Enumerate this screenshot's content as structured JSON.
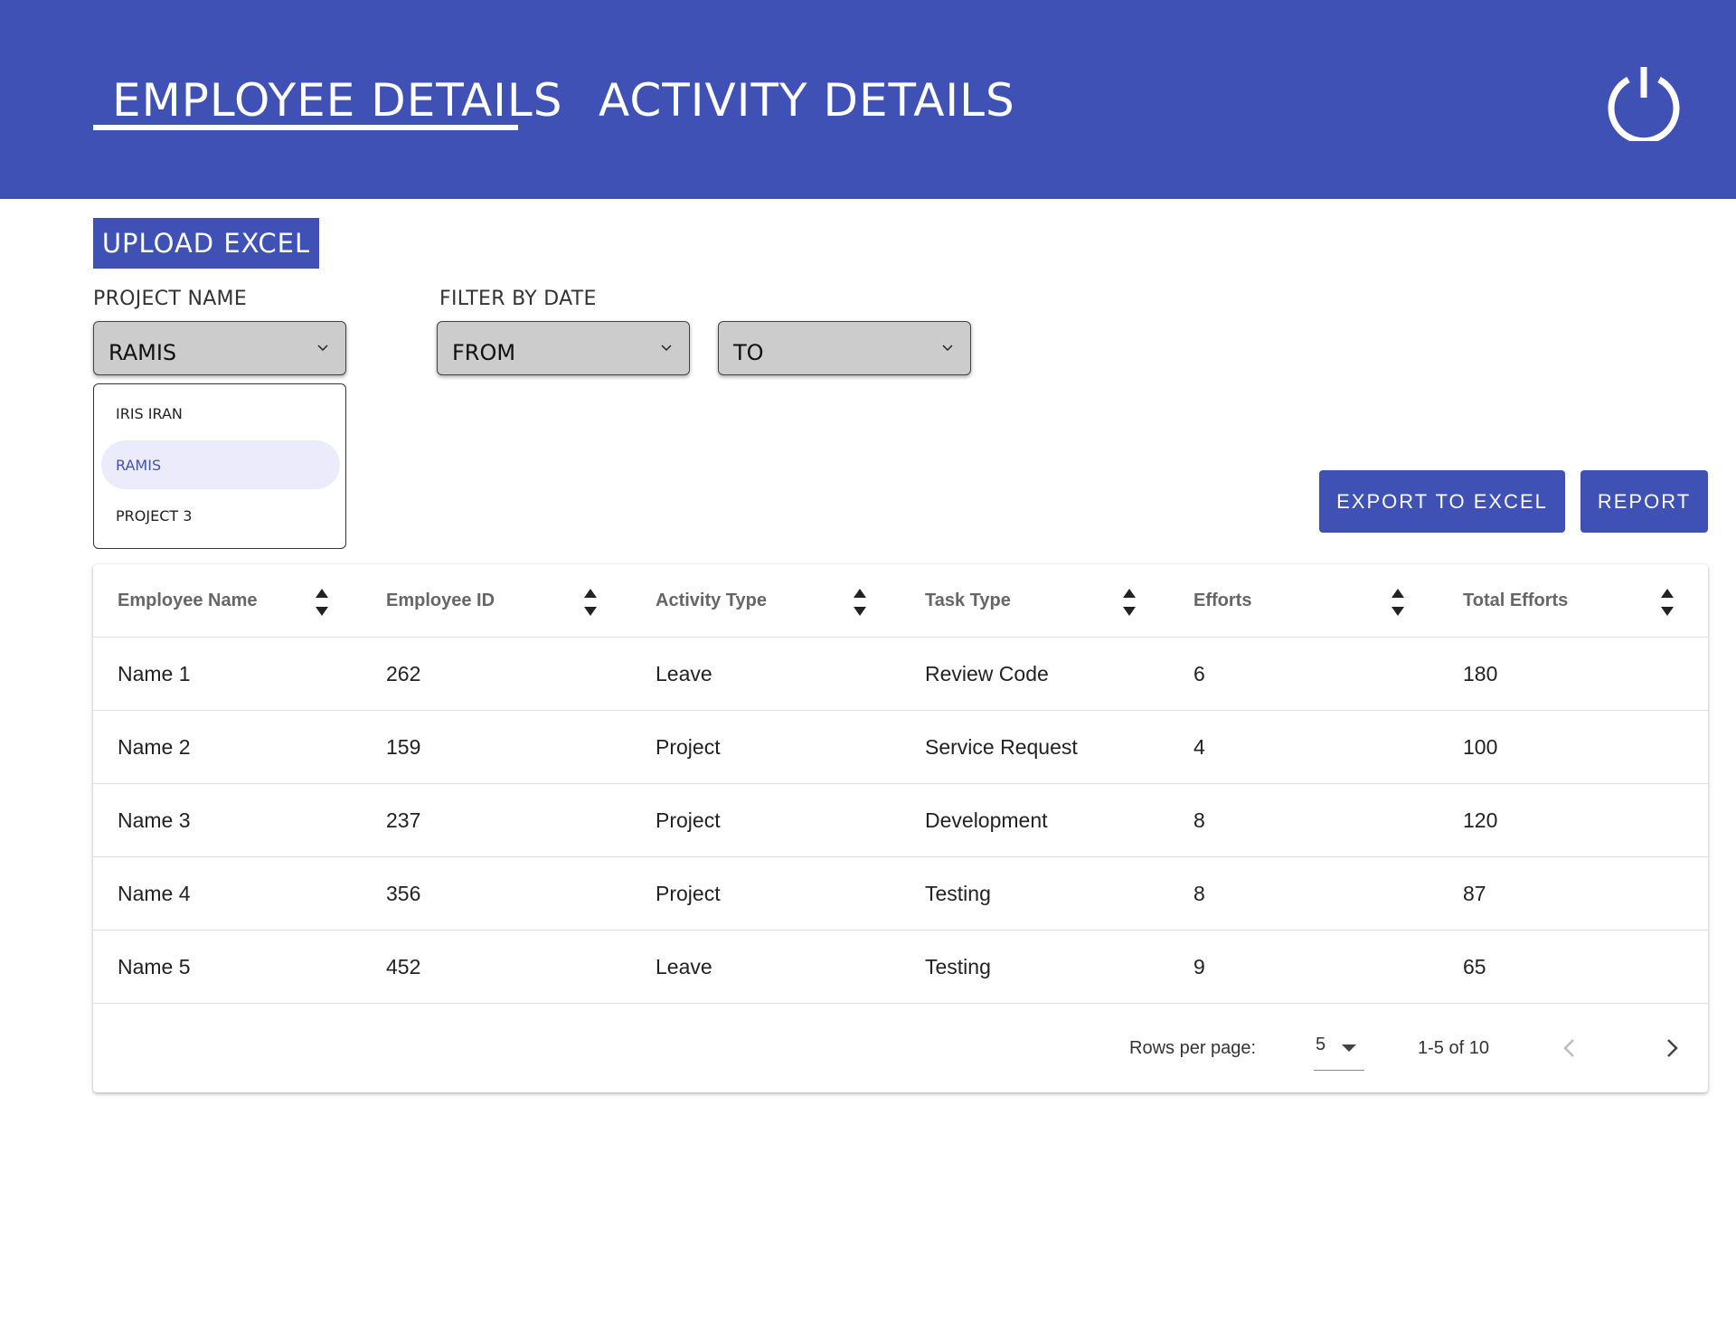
{
  "header": {
    "tabs": [
      {
        "label": "EMPLOYEE DETAILS",
        "active": true
      },
      {
        "label": "ACTIVITY DETAILS",
        "active": false
      }
    ],
    "power_icon": "power-icon",
    "background": "#3f51b5"
  },
  "upload": {
    "label": "UPLOAD EXCEL"
  },
  "filters": {
    "project": {
      "label": "PROJECT NAME",
      "value": "RAMIS",
      "options": [
        {
          "label": "IRIS IRAN",
          "selected": false
        },
        {
          "label": "RAMIS",
          "selected": true
        },
        {
          "label": "PROJECT 3",
          "selected": false
        }
      ]
    },
    "date": {
      "label": "FILTER BY DATE",
      "from": "FROM",
      "to": "TO"
    }
  },
  "actions": {
    "export_label": "EXPORT TO EXCEL",
    "report_label": "REPORT"
  },
  "table": {
    "columns": [
      "Employee Name",
      "Employee ID",
      "Activity Type",
      "Task Type",
      "Efforts",
      "Total Efforts"
    ],
    "rows": [
      [
        "Name 1",
        "262",
        "Leave",
        "Review Code",
        "6",
        "180"
      ],
      [
        "Name 2",
        "159",
        "Project",
        "Service Request",
        "4",
        "100"
      ],
      [
        "Name 3",
        "237",
        "Project",
        "Development",
        "8",
        "120"
      ],
      [
        "Name 4",
        "356",
        "Project",
        "Testing",
        "8",
        "87"
      ],
      [
        "Name 5",
        "452",
        "Leave",
        "Testing",
        "9",
        "65"
      ]
    ],
    "pagination": {
      "rows_per_page_label": "Rows per page:",
      "rows_per_page": "5",
      "range": "1-5 of 10"
    }
  },
  "colors": {
    "accent": "#3f51b5",
    "select_bg": "#cccccc",
    "selected_option_bg": "#ecebfb"
  }
}
